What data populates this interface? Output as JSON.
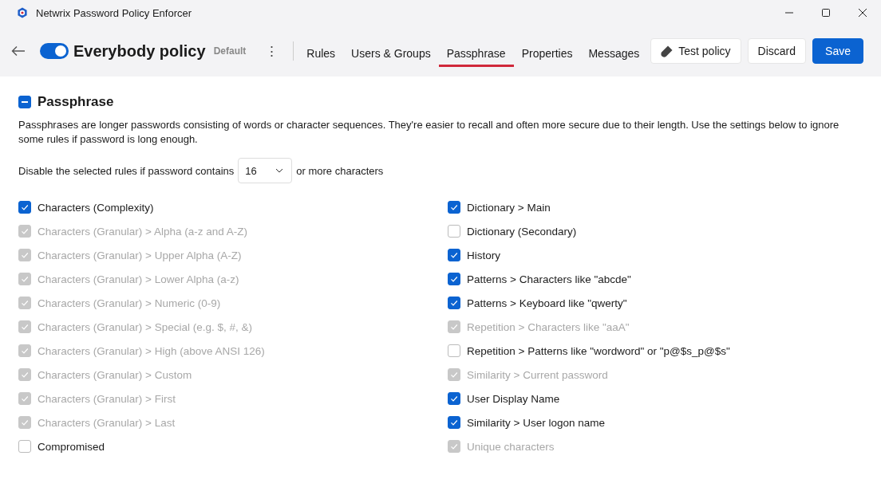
{
  "window": {
    "title": "Netwrix Password Policy Enforcer"
  },
  "header": {
    "enabled": true,
    "policy_name": "Everybody policy",
    "badge": "Default",
    "more": "⋮"
  },
  "tabs": [
    {
      "label": "Rules",
      "selected": false
    },
    {
      "label": "Users & Groups",
      "selected": false
    },
    {
      "label": "Passphrase",
      "selected": true
    },
    {
      "label": "Properties",
      "selected": false
    },
    {
      "label": "Messages",
      "selected": false
    }
  ],
  "buttons": [
    {
      "label": "Test policy",
      "kind": "icon"
    },
    {
      "label": "Discard",
      "kind": "plain"
    },
    {
      "label": "Save",
      "kind": "primary"
    }
  ],
  "section": {
    "title": "Passphrase",
    "indeterminate": true,
    "description": "Passphrases are longer passwords consisting of words or character sequences. They're easier to recall and often more secure due to their length. Use the settings below to ignore some rules if password is long enough.",
    "threshold": {
      "before": "Disable the selected rules if password contains",
      "value": "16",
      "after": "or more characters"
    }
  },
  "columns": [
    [
      {
        "label": "Characters (Complexity)",
        "checked": true,
        "disabled": false
      },
      {
        "label": "Characters (Granular) > Alpha (a-z and A-Z)",
        "checked": true,
        "disabled": true
      },
      {
        "label": "Characters (Granular) > Upper Alpha (A-Z)",
        "checked": true,
        "disabled": true
      },
      {
        "label": "Characters (Granular) > Lower Alpha (a-z)",
        "checked": true,
        "disabled": true
      },
      {
        "label": "Characters (Granular) > Numeric (0-9)",
        "checked": true,
        "disabled": true
      },
      {
        "label": "Characters (Granular) > Special (e.g. $, #, &)",
        "checked": true,
        "disabled": true
      },
      {
        "label": "Characters (Granular) > High (above ANSI 126)",
        "checked": true,
        "disabled": true
      },
      {
        "label": "Characters (Granular) > Custom",
        "checked": true,
        "disabled": true
      },
      {
        "label": "Characters (Granular) > First",
        "checked": true,
        "disabled": true
      },
      {
        "label": "Characters (Granular) > Last",
        "checked": true,
        "disabled": true
      },
      {
        "label": "Compromised",
        "checked": false,
        "disabled": false
      }
    ],
    [
      {
        "label": "Dictionary > Main",
        "checked": true,
        "disabled": false
      },
      {
        "label": "Dictionary (Secondary)",
        "checked": false,
        "disabled": false
      },
      {
        "label": "History",
        "checked": true,
        "disabled": false
      },
      {
        "label": "Patterns > Characters like \"abcde\"",
        "checked": true,
        "disabled": false
      },
      {
        "label": "Patterns > Keyboard like \"qwerty\"",
        "checked": true,
        "disabled": false
      },
      {
        "label": "Repetition > Characters like \"aaA\"",
        "checked": true,
        "disabled": true
      },
      {
        "label": "Repetition > Patterns like \"wordword\" or \"p@$s_p@$s\"",
        "checked": false,
        "disabled": false
      },
      {
        "label": "Similarity > Current password",
        "checked": true,
        "disabled": true
      },
      {
        "label": "User Display Name",
        "checked": true,
        "disabled": false
      },
      {
        "label": "Similarity > User logon name",
        "checked": true,
        "disabled": false
      },
      {
        "label": "Unique characters",
        "checked": true,
        "disabled": true
      }
    ]
  ]
}
